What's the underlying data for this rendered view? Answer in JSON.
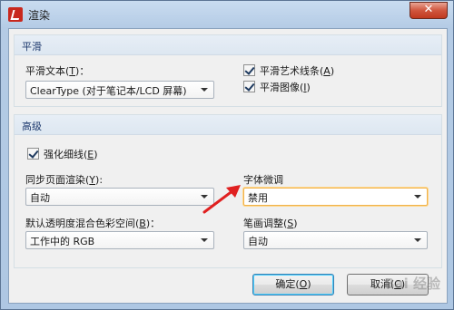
{
  "window": {
    "title": "渲染",
    "close_glyph": "✕"
  },
  "smoothing": {
    "header": "平滑",
    "smooth_text_label": "平滑文本(",
    "smooth_text_key": "T",
    "smooth_text_suffix": ")：",
    "smooth_text_value": "ClearType (对于笔记本/LCD 屏幕)",
    "smooth_lines_label": "平滑艺术线条(",
    "smooth_lines_key": "A",
    "smooth_lines_suffix": ")",
    "smooth_lines_checked": true,
    "smooth_images_label": "平滑图像(",
    "smooth_images_key": "I",
    "smooth_images_suffix": ")",
    "smooth_images_checked": true
  },
  "advanced": {
    "header": "高级",
    "enhance_thin_label": "强化细线(",
    "enhance_thin_key": "E",
    "enhance_thin_suffix": ")",
    "enhance_thin_checked": true,
    "sync_render_label": "同步页面渲染(",
    "sync_render_key": "Y",
    "sync_render_suffix": "):",
    "sync_render_value": "自动",
    "font_tuning_label": "字体微调",
    "font_tuning_value": "禁用",
    "blend_space_label": "默认透明度混合色彩空间(",
    "blend_space_key": "B",
    "blend_space_suffix": ")：",
    "blend_space_value": "工作中的 RGB",
    "stroke_adjust_label": "笔画调整(",
    "stroke_adjust_key": "S",
    "stroke_adjust_suffix": ")",
    "stroke_adjust_value": "自动"
  },
  "footer": {
    "ok_label": "确定(",
    "ok_key": "O",
    "ok_suffix": ")",
    "cancel_label": "取消(",
    "cancel_key": "C",
    "cancel_suffix": ")"
  },
  "watermark": "Bai 经验",
  "colors": {
    "annotation_arrow": "#e02020",
    "accent_border": "#f0b24c"
  }
}
